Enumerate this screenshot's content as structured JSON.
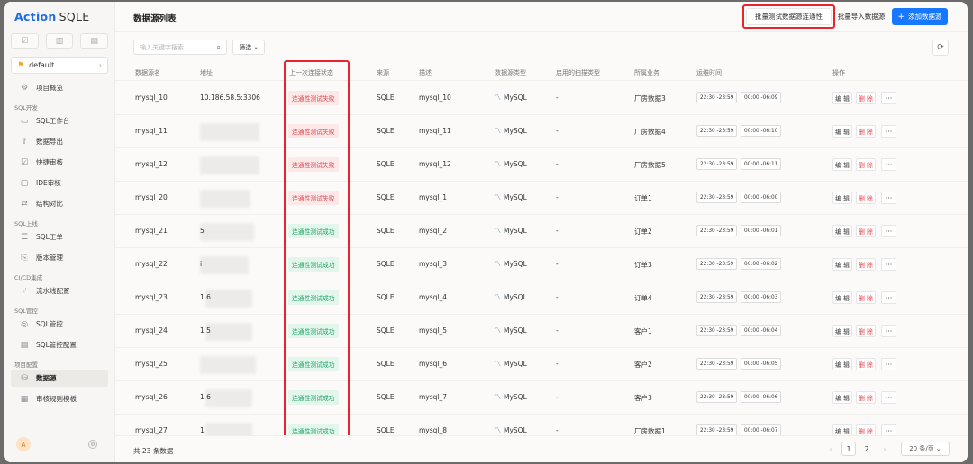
{
  "app": {
    "logo_action": "Action",
    "logo_sqle": "SQLE"
  },
  "sidebar": {
    "project": "default",
    "overview": "项目概览",
    "groups": [
      {
        "title": "SQL开发",
        "items": [
          "SQL工作台",
          "数据导出",
          "快捷审核",
          "IDE审核",
          "结构对比"
        ]
      },
      {
        "title": "SQL上线",
        "items": [
          "SQL工单",
          "版本管理"
        ]
      },
      {
        "title": "CI/CD集成",
        "items": [
          "流水线配置"
        ]
      },
      {
        "title": "SQL管控",
        "items": [
          "SQL管控",
          "SQL管控配置"
        ]
      },
      {
        "title": "项目配置",
        "items": [
          "数据源",
          "审核规则模板"
        ]
      }
    ],
    "active_item": "数据源",
    "avatar_letter": "A"
  },
  "header": {
    "title": "数据源列表",
    "batch_test_label": "批量测试数据源连通性",
    "batch_import_label": "批量导入数据源",
    "add_label": "添加数据源"
  },
  "toolbar": {
    "search_placeholder": "输入关键字搜索",
    "filter_label": "筛选"
  },
  "table": {
    "columns": [
      "数据源名",
      "地址",
      "上一次连接状态",
      "来源",
      "描述",
      "数据源类型",
      "启用的扫描类型",
      "所属业务",
      "运维时间",
      "操作"
    ],
    "rows": [
      {
        "name": "mysql_10",
        "address": "10.186.58.5:3306",
        "status": "连通性测试失败",
        "status_type": "fail",
        "source": "SQLE",
        "desc": "mysql_10",
        "type": "MySQL",
        "scan": "-",
        "business": "厂房数据3",
        "time1": "22:30 -23:59",
        "time2": "00:00 -06:09"
      },
      {
        "name": "mysql_11",
        "address": "",
        "status": "连通性测试失败",
        "status_type": "fail",
        "source": "SQLE",
        "desc": "mysql_11",
        "type": "MySQL",
        "scan": "-",
        "business": "厂房数据4",
        "time1": "22:30 -23:59",
        "time2": "00:00 -06:10"
      },
      {
        "name": "mysql_12",
        "address": "",
        "status": "连通性测试失败",
        "status_type": "fail",
        "source": "SQLE",
        "desc": "mysql_12",
        "type": "MySQL",
        "scan": "-",
        "business": "厂房数据5",
        "time1": "22:30 -23:59",
        "time2": "00:00 -06:11"
      },
      {
        "name": "mysql_20",
        "address": "",
        "status": "连通性测试失败",
        "status_type": "fail",
        "source": "SQLE",
        "desc": "mysql_1",
        "type": "MySQL",
        "scan": "-",
        "business": "订单1",
        "time1": "22:30 -23:59",
        "time2": "00:00 -06:00"
      },
      {
        "name": "mysql_21",
        "address": "5",
        "status": "连通性测试成功",
        "status_type": "ok",
        "source": "SQLE",
        "desc": "mysql_2",
        "type": "MySQL",
        "scan": "-",
        "business": "订单2",
        "time1": "22:30 -23:59",
        "time2": "00:00 -06:01"
      },
      {
        "name": "mysql_22",
        "address": "i",
        "status": "连通性测试成功",
        "status_type": "ok",
        "source": "SQLE",
        "desc": "mysql_3",
        "type": "MySQL",
        "scan": "-",
        "business": "订单3",
        "time1": "22:30 -23:59",
        "time2": "00:00 -06:02"
      },
      {
        "name": "mysql_23",
        "address": "1 6",
        "status": "连通性测试成功",
        "status_type": "ok",
        "source": "SQLE",
        "desc": "mysql_4",
        "type": "MySQL",
        "scan": "-",
        "business": "订单4",
        "time1": "22:30 -23:59",
        "time2": "00:00 -06:03"
      },
      {
        "name": "mysql_24",
        "address": "1 5",
        "status": "连通性测试成功",
        "status_type": "ok",
        "source": "SQLE",
        "desc": "mysql_5",
        "type": "MySQL",
        "scan": "-",
        "business": "客户1",
        "time1": "22:30 -23:59",
        "time2": "00:00 -06:04"
      },
      {
        "name": "mysql_25",
        "address": "",
        "status": "连通性测试成功",
        "status_type": "ok",
        "source": "SQLE",
        "desc": "mysql_6",
        "type": "MySQL",
        "scan": "-",
        "business": "客户2",
        "time1": "22:30 -23:59",
        "time2": "00:00 -06:05"
      },
      {
        "name": "mysql_26",
        "address": "1 6",
        "status": "连通性测试成功",
        "status_type": "ok",
        "source": "SQLE",
        "desc": "mysql_7",
        "type": "MySQL",
        "scan": "-",
        "business": "客户3",
        "time1": "22:30 -23:59",
        "time2": "00:00 -06:06"
      },
      {
        "name": "mysql_27",
        "address": "1",
        "status": "连通性测试成功",
        "status_type": "ok",
        "source": "SQLE",
        "desc": "mysql_8",
        "type": "MySQL",
        "scan": "-",
        "business": "厂房数据1",
        "time1": "22:30 -23:59",
        "time2": "00:00 -06:07"
      }
    ],
    "edit_label": "编 辑",
    "delete_label": "删 除",
    "more_label": "···"
  },
  "footer": {
    "total_text": "共 23 条数据",
    "pages": [
      "1",
      "2"
    ],
    "current_page": "1",
    "page_size": "20 条/页"
  },
  "colors": {
    "accent": "#1677ff",
    "highlight_box": "#e8252d",
    "fail": "#e0464e",
    "success": "#20a464"
  }
}
